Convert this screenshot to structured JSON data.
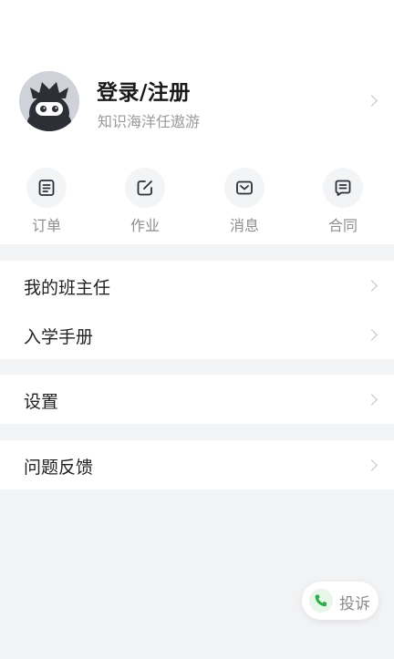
{
  "profile": {
    "title": "登录/注册",
    "subtitle": "知识海洋任遨游",
    "avatar_icon": "ninja-avatar"
  },
  "quick_actions": [
    {
      "label": "订单",
      "icon": "order-list-icon"
    },
    {
      "label": "作业",
      "icon": "edit-icon"
    },
    {
      "label": "消息",
      "icon": "mail-icon"
    },
    {
      "label": "合同",
      "icon": "contract-icon"
    }
  ],
  "menu": {
    "head_teacher": "我的班主任",
    "enrollment_handbook": "入学手册",
    "settings": "设置",
    "feedback": "问题反馈"
  },
  "complaint": {
    "label": "投诉",
    "icon": "phone-icon",
    "accent": "#2eae4a"
  },
  "colors": {
    "background": "#f2f3f5",
    "card": "#ffffff",
    "icon_stroke": "#2a2f3a"
  }
}
